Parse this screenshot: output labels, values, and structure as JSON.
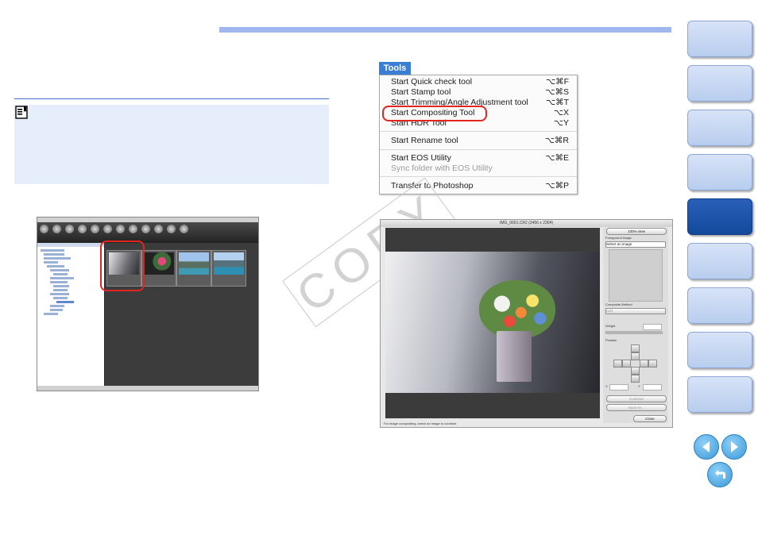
{
  "tools_menu": {
    "title": "Tools",
    "items": [
      {
        "label": "Start Quick check tool",
        "shortcut": "⌥⌘F"
      },
      {
        "label": "Start Stamp tool",
        "shortcut": "⌥⌘S"
      },
      {
        "label": "Start Trimming/Angle Adjustment tool",
        "shortcut": "⌥⌘T"
      },
      {
        "label": "Start Compositing Tool",
        "shortcut": "⌥X"
      },
      {
        "label": "Start HDR Tool",
        "shortcut": "⌥Y"
      },
      {
        "label": "Start Rename tool",
        "shortcut": "⌥⌘R"
      },
      {
        "label": "Start EOS Utility",
        "shortcut": "⌥⌘E"
      },
      {
        "label": "Sync folder with EOS Utility",
        "shortcut": ""
      },
      {
        "label": "Transfer to Photoshop",
        "shortcut": "⌥⌘P"
      }
    ]
  },
  "compositing_window": {
    "title": "IMG_0001.CR2 (3456 x 2304)",
    "view_button": "100% view",
    "foreground_label": "Foreground image",
    "foreground_select": "Select an image",
    "method_label": "Composite Method",
    "method_value": "Add",
    "weight_label": "Weight",
    "position_label": "Position",
    "x_label": "X",
    "y_label": "Y",
    "continue_button": "Continue",
    "save_as_button": "Save As...",
    "close_button": "Close",
    "status": "For image compositing, select an image to combine."
  },
  "watermark": "COPY",
  "colors": {
    "accent_blue": "#9fb6ee",
    "highlight_red": "#e2261f",
    "nav_active": "#134a9c"
  }
}
